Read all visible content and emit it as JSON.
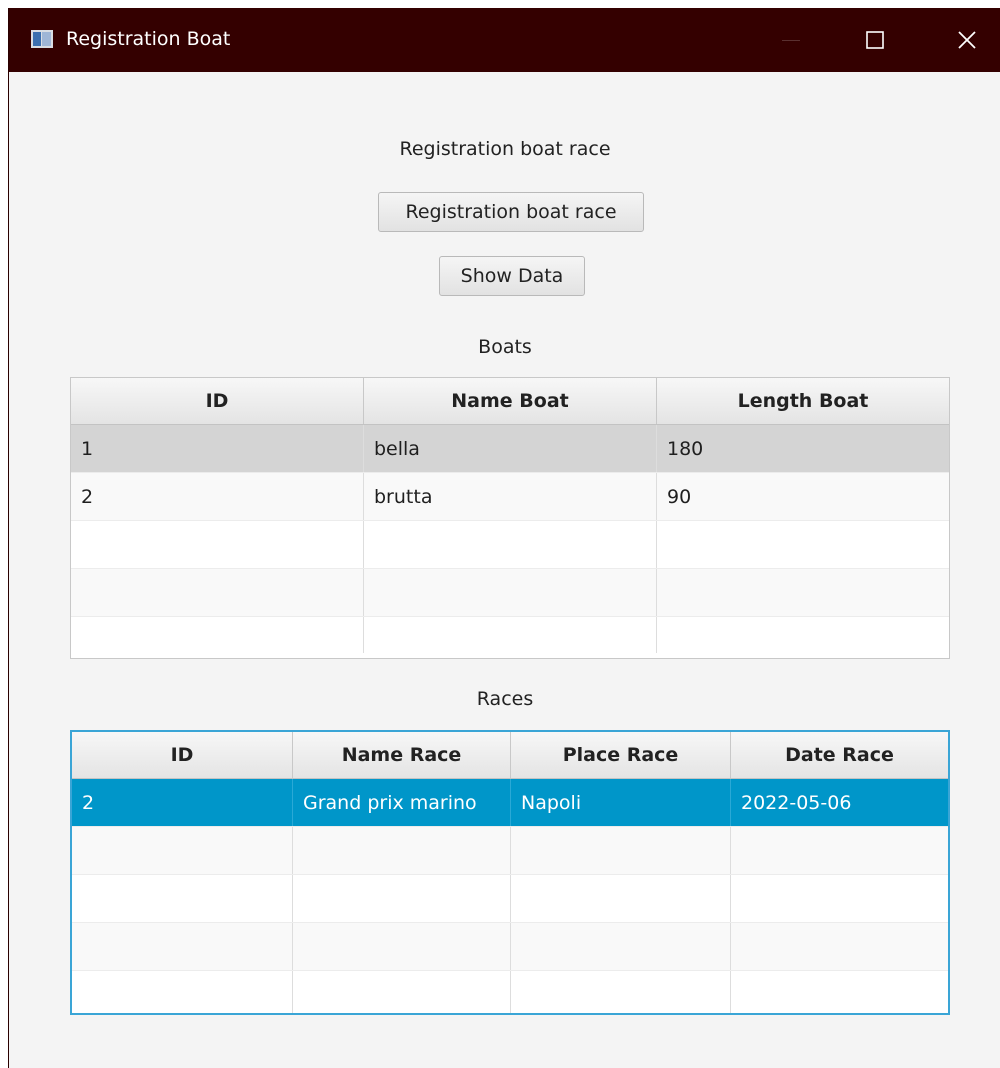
{
  "window": {
    "title": "Registration Boat",
    "colors": {
      "titlebar": "#340000",
      "selection": "#0096c9",
      "focus_border": "#3aa5d6"
    }
  },
  "main": {
    "heading": "Registration boat race",
    "register_button": "Registration boat race",
    "show_data_button": "Show Data"
  },
  "boats": {
    "label": "Boats",
    "columns": [
      "ID",
      "Name Boat",
      "Length Boat"
    ],
    "rows": [
      [
        "1",
        "bella",
        "180"
      ],
      [
        "2",
        "brutta",
        "90"
      ]
    ]
  },
  "races": {
    "label": "Races",
    "columns": [
      "ID",
      "Name Race",
      "Place Race",
      "Date Race"
    ],
    "rows": [
      [
        "2",
        "Grand prix marino",
        "Napoli",
        "2022-05-06"
      ]
    ]
  }
}
